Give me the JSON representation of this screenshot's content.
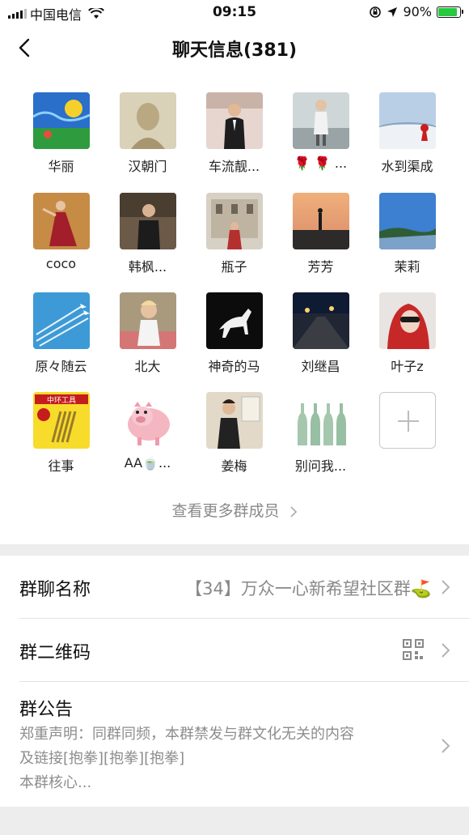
{
  "status_bar": {
    "carrier": "中国电信",
    "time": "09:15",
    "battery_percent": "90%",
    "battery_level": 0.9,
    "icons": [
      "signal-icon",
      "wifi-icon",
      "orientation-lock-icon",
      "location-icon",
      "battery-icon"
    ]
  },
  "nav": {
    "title": "聊天信息(381)",
    "back_icon": "back-arrow-icon"
  },
  "members": [
    {
      "name": "华丽"
    },
    {
      "name": "汉朝门"
    },
    {
      "name": "车流靓..."
    },
    {
      "name": "🌹 🌹 ..."
    },
    {
      "name": "水到渠成"
    },
    {
      "name": "coco"
    },
    {
      "name": "韩枫..."
    },
    {
      "name": "瓶子"
    },
    {
      "name": "芳芳"
    },
    {
      "name": "茉莉"
    },
    {
      "name": "原々随云"
    },
    {
      "name": "北大"
    },
    {
      "name": "神奇的马"
    },
    {
      "name": "刘继昌"
    },
    {
      "name": "叶子z"
    },
    {
      "name": "往事",
      "avatar_text": "中环工具"
    },
    {
      "name": "AA🍵..."
    },
    {
      "name": "姜梅"
    },
    {
      "name": "别问我..."
    }
  ],
  "add_member_icon": "plus-icon",
  "view_more": "查看更多群成员",
  "settings": {
    "group_name_label": "群聊名称",
    "group_name_value": "【34】万众一心新希望社区群⛳",
    "qrcode_label": "群二维码",
    "qrcode_icon": "qrcode-icon",
    "notice_label": "群公告",
    "notice_line1": "郑重声明：同群同频，本群禁发与群文化无关的内容",
    "notice_line2": "及链接[抱拳][抱拳][抱拳]",
    "notice_line3": "本群核心..."
  },
  "colors": {
    "battery_green": "#27c93f",
    "background_gray": "#ededed",
    "secondary_text": "#888888"
  }
}
